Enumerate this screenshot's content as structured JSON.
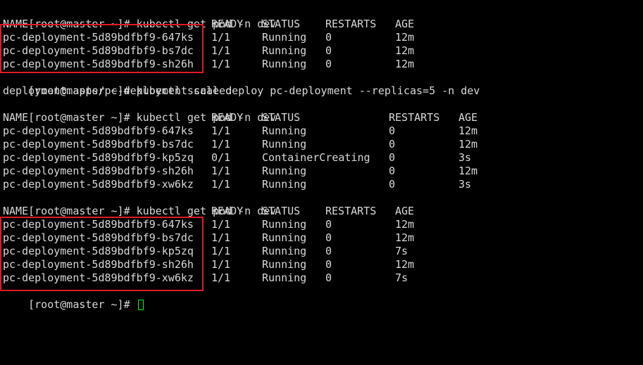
{
  "terminal": {
    "prompt": "[root@master ~]# ",
    "commands": [
      "kubectl get pod -n dev",
      "kubectl scale deploy pc-deployment --replicas=5 -n dev",
      "kubectl get pod -n dev",
      "kubectl get pod -n dev"
    ],
    "scale_output": "deployment.apps/pc-deployment scaled",
    "headers": {
      "name": "NAME",
      "ready": "READY",
      "status": "STATUS",
      "restarts": "RESTARTS",
      "age": "AGE"
    },
    "table1": [
      {
        "name": "pc-deployment-5d89bdfbf9-647ks",
        "ready": "1/1",
        "status": "Running",
        "restarts": "0",
        "age": "12m"
      },
      {
        "name": "pc-deployment-5d89bdfbf9-bs7dc",
        "ready": "1/1",
        "status": "Running",
        "restarts": "0",
        "age": "12m"
      },
      {
        "name": "pc-deployment-5d89bdfbf9-sh26h",
        "ready": "1/1",
        "status": "Running",
        "restarts": "0",
        "age": "12m"
      }
    ],
    "table2": [
      {
        "name": "pc-deployment-5d89bdfbf9-647ks",
        "ready": "1/1",
        "status": "Running",
        "restarts": "0",
        "age": "12m"
      },
      {
        "name": "pc-deployment-5d89bdfbf9-bs7dc",
        "ready": "1/1",
        "status": "Running",
        "restarts": "0",
        "age": "12m"
      },
      {
        "name": "pc-deployment-5d89bdfbf9-kp5zq",
        "ready": "0/1",
        "status": "ContainerCreating",
        "restarts": "0",
        "age": "3s"
      },
      {
        "name": "pc-deployment-5d89bdfbf9-sh26h",
        "ready": "1/1",
        "status": "Running",
        "restarts": "0",
        "age": "12m"
      },
      {
        "name": "pc-deployment-5d89bdfbf9-xw6kz",
        "ready": "1/1",
        "status": "Running",
        "restarts": "0",
        "age": "3s"
      }
    ],
    "table3": [
      {
        "name": "pc-deployment-5d89bdfbf9-647ks",
        "ready": "1/1",
        "status": "Running",
        "restarts": "0",
        "age": "12m"
      },
      {
        "name": "pc-deployment-5d89bdfbf9-bs7dc",
        "ready": "1/1",
        "status": "Running",
        "restarts": "0",
        "age": "12m"
      },
      {
        "name": "pc-deployment-5d89bdfbf9-kp5zq",
        "ready": "1/1",
        "status": "Running",
        "restarts": "0",
        "age": "7s"
      },
      {
        "name": "pc-deployment-5d89bdfbf9-sh26h",
        "ready": "1/1",
        "status": "Running",
        "restarts": "0",
        "age": "12m"
      },
      {
        "name": "pc-deployment-5d89bdfbf9-xw6kz",
        "ready": "1/1",
        "status": "Running",
        "restarts": "0",
        "age": "7s"
      }
    ]
  },
  "colors": {
    "background": "#000000",
    "text": "#d8d8d8",
    "highlight": "#e01b24",
    "cursor": "#00ff00"
  }
}
